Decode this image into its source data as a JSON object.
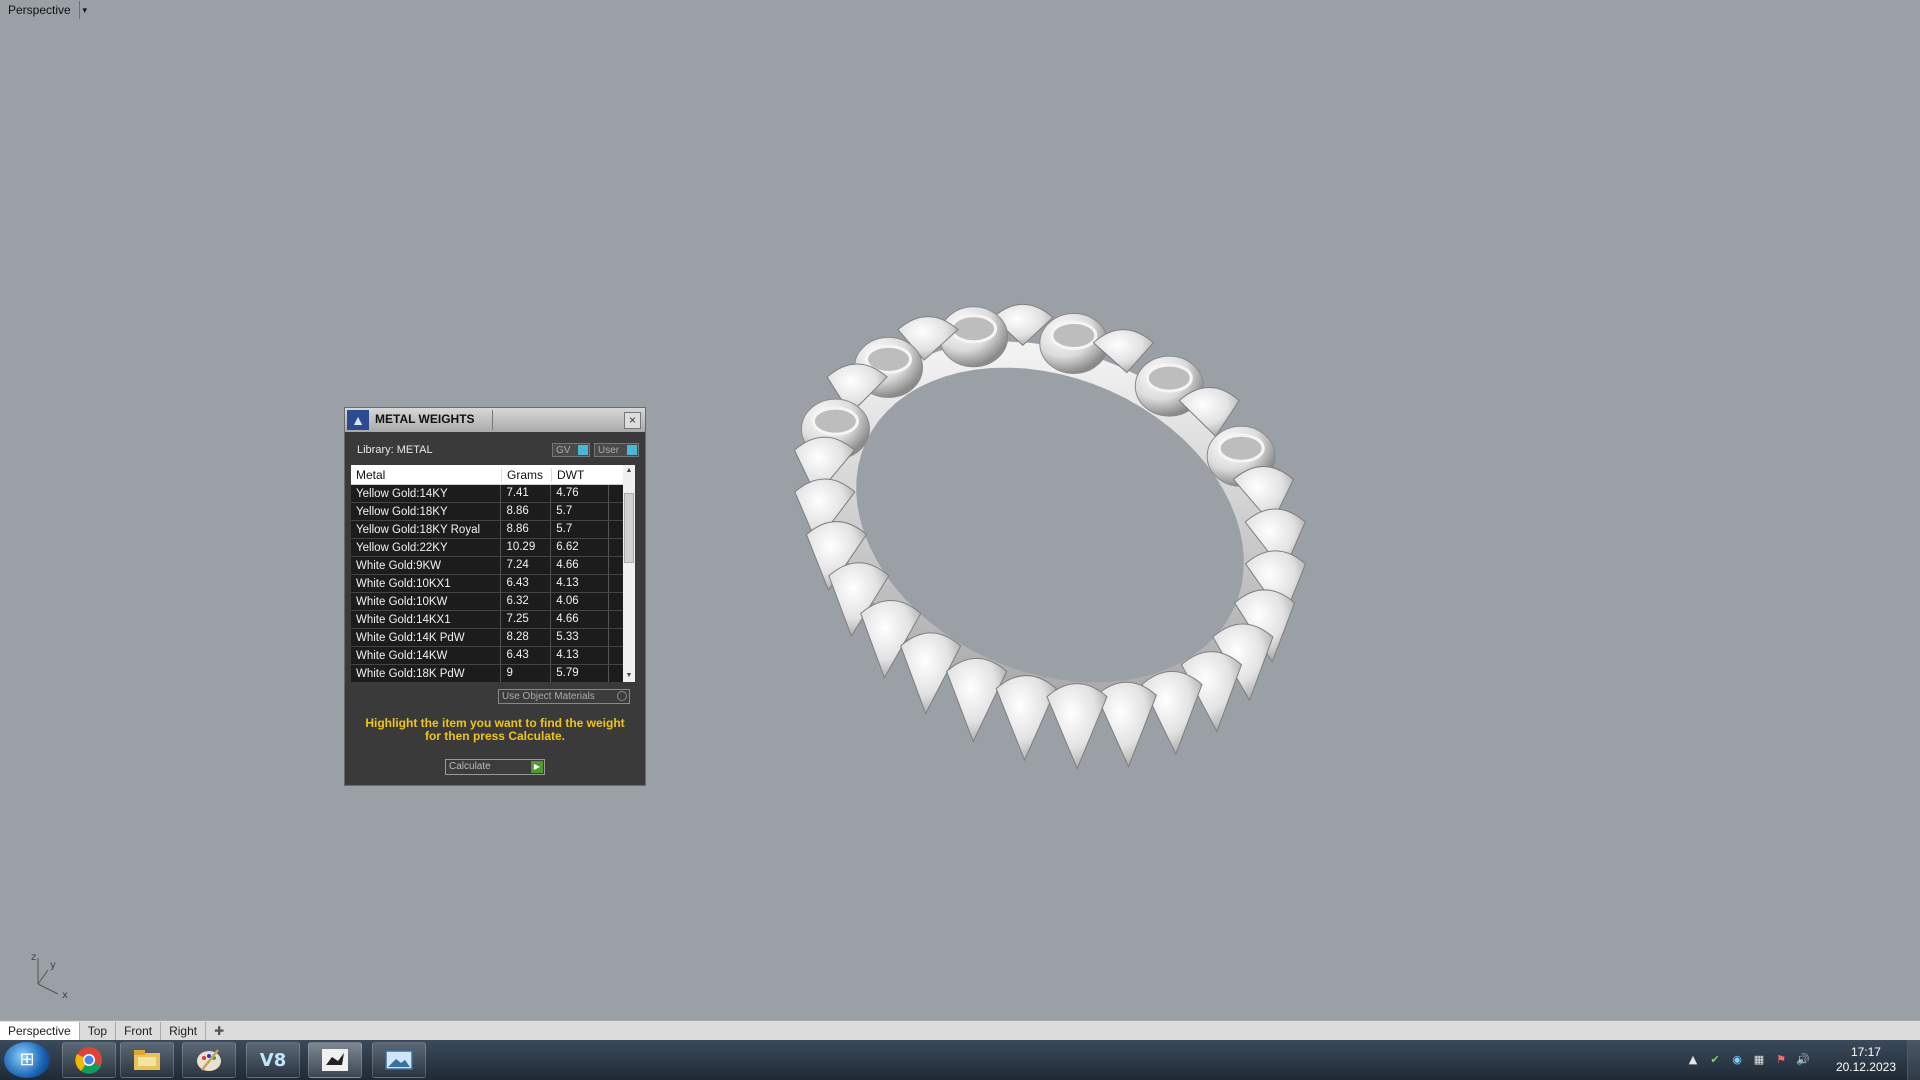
{
  "viewport": {
    "label": "Perspective",
    "menu_arrow": "▾"
  },
  "axis": {
    "z": "z",
    "y": "y",
    "x": "x"
  },
  "panel": {
    "title": "METAL WEIGHTS",
    "close_glyph": "×",
    "library_label": "Library: METAL",
    "toggle_gv": "GV",
    "toggle_user": "User",
    "columns": [
      "Metal",
      "Grams",
      "DWT"
    ],
    "rows": [
      {
        "metal": "Yellow Gold:14KY",
        "grams": "7.41",
        "dwt": "4.76"
      },
      {
        "metal": "Yellow Gold:18KY",
        "grams": "8.86",
        "dwt": "5.7"
      },
      {
        "metal": "Yellow Gold:18KY Royal",
        "grams": "8.86",
        "dwt": "5.7"
      },
      {
        "metal": "Yellow Gold:22KY",
        "grams": "10.29",
        "dwt": "6.62"
      },
      {
        "metal": "White Gold:9KW",
        "grams": "7.24",
        "dwt": "4.66"
      },
      {
        "metal": "White Gold:10KX1",
        "grams": "6.43",
        "dwt": "4.13"
      },
      {
        "metal": "White Gold:10KW",
        "grams": "6.32",
        "dwt": "4.06"
      },
      {
        "metal": "White Gold:14KX1",
        "grams": "7.25",
        "dwt": "4.66"
      },
      {
        "metal": "White Gold:14K PdW",
        "grams": "8.28",
        "dwt": "5.33"
      },
      {
        "metal": "White Gold:14KW",
        "grams": "6.43",
        "dwt": "4.13"
      },
      {
        "metal": "White Gold:18K PdW",
        "grams": "9",
        "dwt": "5.79"
      }
    ],
    "use_object_materials": "Use Object Materials",
    "hint": "Highlight the item you want to find the weight for then press Calculate.",
    "calculate": "Calculate"
  },
  "viewport_tabs": [
    "Perspective",
    "Top",
    "Front",
    "Right"
  ],
  "add_tab_glyph": "✚",
  "taskbar": {
    "apps": [
      "chrome-icon",
      "file-explorer-icon",
      "paint-icon",
      "v8-icon",
      "rhino-icon",
      "image-viewer-icon"
    ],
    "v8_label": "V8",
    "time": "17:17",
    "date": "20.12.2023"
  }
}
